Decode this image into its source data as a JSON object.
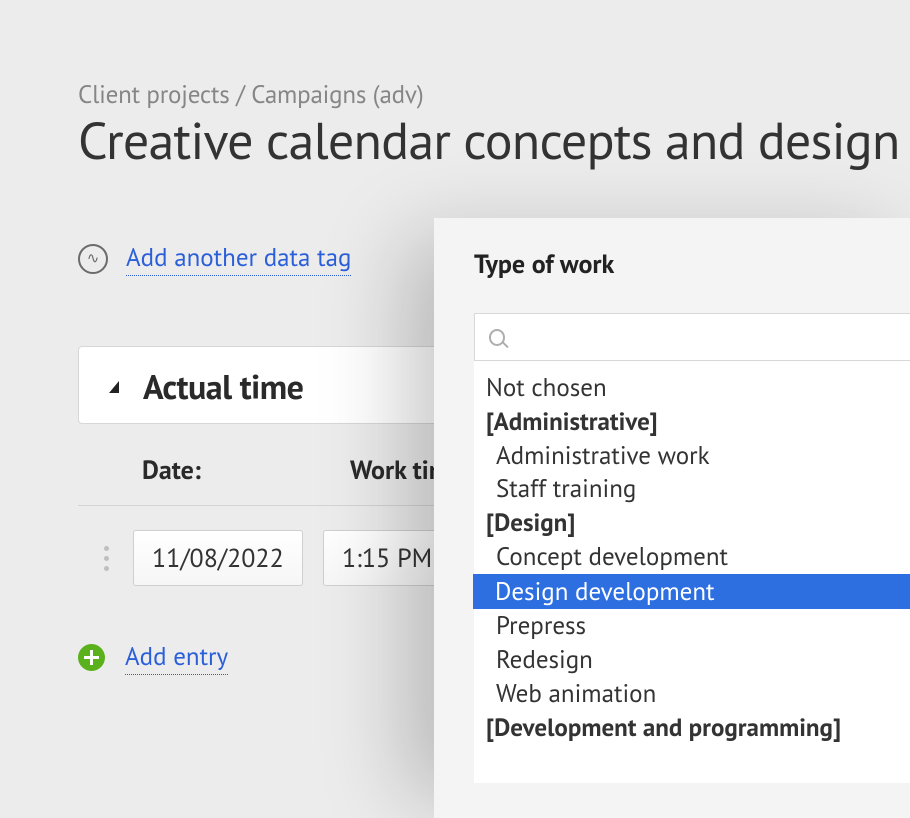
{
  "breadcrumb": "Client projects / Campaigns (adv)",
  "page_title": "Creative calendar concepts and design",
  "add_tag_link": "Add another data tag",
  "panel": {
    "title": "Actual time"
  },
  "table": {
    "headers": {
      "date": "Date:",
      "work_time": "Work time:"
    },
    "row": {
      "date": "11/08/2022",
      "time": "1:15 PM"
    }
  },
  "add_entry_link": "Add entry",
  "dropdown": {
    "title": "Type of work",
    "search_placeholder": "",
    "options": {
      "not_chosen": "Not chosen",
      "group_admin": "[Administrative]",
      "admin_work": "Administrative work",
      "staff_training": "Staff training",
      "group_design": "[Design]",
      "concept_dev": "Concept development",
      "design_dev": "Design development",
      "prepress": "Prepress",
      "redesign": "Redesign",
      "web_anim": "Web animation",
      "group_dev": "[Development and programming]"
    }
  }
}
